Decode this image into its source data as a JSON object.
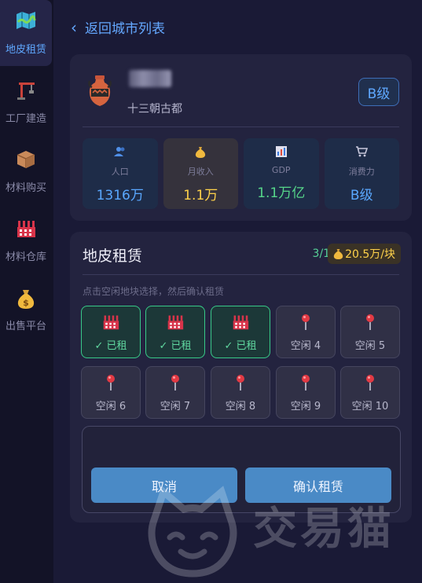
{
  "sidebar": {
    "items": [
      {
        "label": "地皮租赁",
        "icon": "map-icon"
      },
      {
        "label": "工厂建造",
        "icon": "crane-icon"
      },
      {
        "label": "材料购买",
        "icon": "box-icon"
      },
      {
        "label": "材料仓库",
        "icon": "factory-icon"
      },
      {
        "label": "出售平台",
        "icon": "money-bag-icon"
      }
    ]
  },
  "back": {
    "label": "返回城市列表"
  },
  "city": {
    "subtitle": "十三朝古都",
    "grade": "B级",
    "stats": [
      {
        "label": "人口",
        "value": "1316万",
        "color": "#5aa8ff",
        "icon": "people-icon"
      },
      {
        "label": "月收入",
        "value": "1.1万",
        "color": "#ffd24a",
        "icon": "money-bag-icon"
      },
      {
        "label": "GDP",
        "value": "1.1万亿",
        "color": "#56d68a",
        "icon": "chart-icon"
      },
      {
        "label": "消费力",
        "value": "B级",
        "color": "#5aa8ff",
        "icon": "cart-icon"
      }
    ]
  },
  "lease": {
    "title": "地皮租赁",
    "count": "3/10",
    "price": "20.5万/块",
    "hint": "点击空闲地块选择，然后确认租赁",
    "plots": [
      {
        "label": "✓ 已租",
        "status": "rented"
      },
      {
        "label": "✓ 已租",
        "status": "rented"
      },
      {
        "label": "✓ 已租",
        "status": "rented"
      },
      {
        "label": "空闲 4",
        "status": "free"
      },
      {
        "label": "空闲 5",
        "status": "free"
      },
      {
        "label": "空闲 6",
        "status": "free"
      },
      {
        "label": "空闲 7",
        "status": "free"
      },
      {
        "label": "空闲 8",
        "status": "free"
      },
      {
        "label": "空闲 9",
        "status": "free"
      },
      {
        "label": "空闲 10",
        "status": "free"
      }
    ],
    "cancel_label": "取消",
    "confirm_label": "确认租赁"
  },
  "watermark": {
    "text": "交易猫"
  },
  "colors": {
    "accent": "#5fa8ff",
    "rented": "#38c988",
    "gold": "#ffd24a",
    "button": "#4a8ac6"
  }
}
